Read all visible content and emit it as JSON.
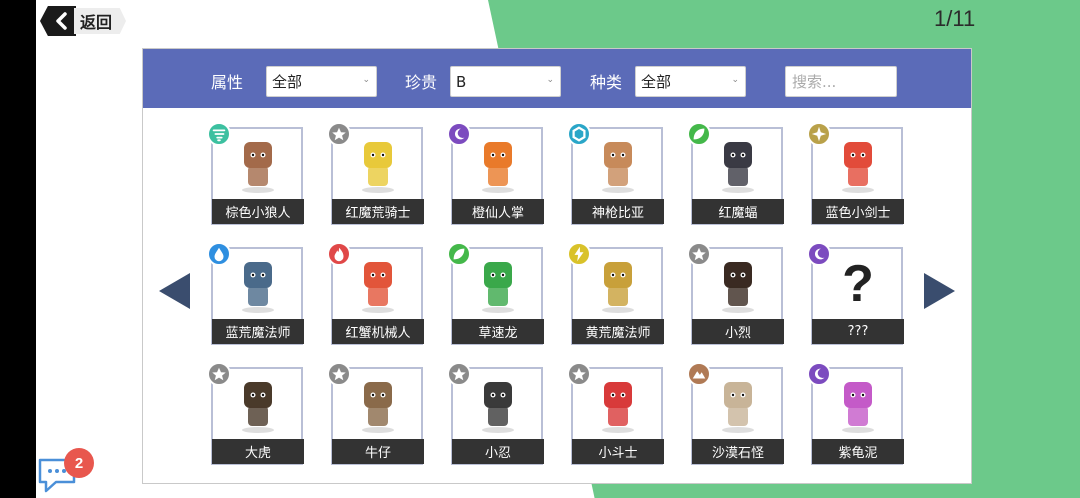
{
  "header": {
    "back_label": "返回",
    "page_indicator": "1/11"
  },
  "filters": {
    "attribute_label": "属性",
    "attribute_value": "全部",
    "rarity_label": "珍贵",
    "rarity_value": "B",
    "species_label": "种类",
    "species_value": "全部",
    "search_placeholder": "搜索..."
  },
  "colors": {
    "filter_bar": "#5b6bb8",
    "green_bg": "#6cc98a",
    "nav_arrow": "#3a4d6e",
    "wind": "#3cc0a0",
    "neutral": "#8a8a8a",
    "dark": "#7c4bbf",
    "light": "#2aa6c8",
    "grass": "#44b84a",
    "star": "#b9a14a",
    "water": "#2f8fe0",
    "fire": "#e04848",
    "electric": "#d9c22a",
    "earth": "#b07a55",
    "notification": "#e8574e"
  },
  "monsters": [
    {
      "name": "棕色小狼人",
      "element_icon": "wind-icon"
    },
    {
      "name": "红魔荒骑士",
      "element_icon": "neutral-star-icon"
    },
    {
      "name": "橙仙人掌",
      "element_icon": "dark-moon-icon"
    },
    {
      "name": "神枪比亚",
      "element_icon": "light-ring-icon"
    },
    {
      "name": "红魔蝠",
      "element_icon": "grass-leaf-icon"
    },
    {
      "name": "蓝色小剑士",
      "element_icon": "sparkle-star-icon"
    },
    {
      "name": "蓝荒魔法师",
      "element_icon": "water-drop-icon"
    },
    {
      "name": "红蟹机械人",
      "element_icon": "fire-icon"
    },
    {
      "name": "草速龙",
      "element_icon": "grass-leaf-icon"
    },
    {
      "name": "黄荒魔法师",
      "element_icon": "lightning-icon"
    },
    {
      "name": "小烈",
      "element_icon": "neutral-star-icon"
    },
    {
      "name": "???",
      "element_icon": "dark-moon-icon"
    },
    {
      "name": "大虎",
      "element_icon": "neutral-star-icon"
    },
    {
      "name": "牛仔",
      "element_icon": "neutral-star-icon"
    },
    {
      "name": "小忍",
      "element_icon": "neutral-star-icon"
    },
    {
      "name": "小斗士",
      "element_icon": "neutral-star-icon"
    },
    {
      "name": "沙漠石怪",
      "element_icon": "earth-mountain-icon"
    },
    {
      "name": "紫龟泥",
      "element_icon": "dark-moon-icon"
    }
  ],
  "chat": {
    "unread_count": "2"
  }
}
